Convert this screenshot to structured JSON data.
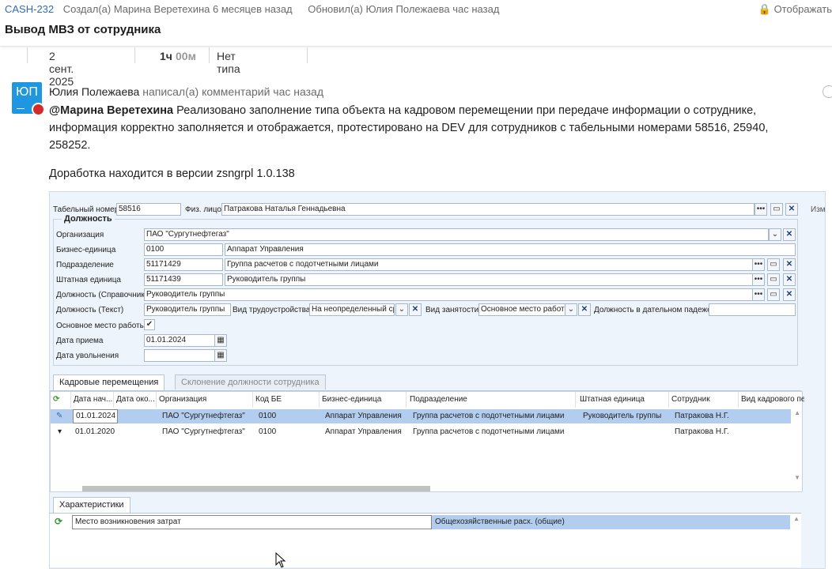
{
  "header": {
    "issue_key": "CASH-232",
    "created": "Создал(а) Марина Веретехина 6 месяцев назад",
    "updated": "Обновил(а) Юлия Полежаева час назад",
    "visibility": "Отображать",
    "title": "Вывод МВЗ от сотрудника"
  },
  "meta": {
    "date": "2 сент. 2025",
    "time_h": "1ч",
    "time_m": "00м",
    "type": "Нет типа"
  },
  "comment": {
    "avatar_initials": "ЮП",
    "author": "Юлия Полежаева",
    "action": "написал(а) комментарий час назад",
    "mention": "@Марина Веретехина",
    "text1": " Реализовано заполнение типа объекта на кадровом перемещении при передаче информации о сотруднике, информация корректно заполняется и отображается, протестировано на DEV для сотрудников с табельными номерами 58516, 25940, 258252.",
    "text2": "Доработка находится в версии zsngrpl 1.0.138"
  },
  "form": {
    "tab_num_label": "Табельный номер",
    "tab_num": "58516",
    "fiz_label": "Физ. лицо",
    "fiz_value": "Патракова Наталья Геннадьевна",
    "izm_label": "Изм",
    "group_title": "Должность",
    "org_label": "Организация",
    "org_value": "ПАО \"Сургутнефтегаз\"",
    "be_label": "Бизнес-единица",
    "be_code": "0100",
    "be_value": "Аппарат Управления",
    "podr_label": "Подразделение",
    "podr_code": "51171429",
    "podr_value": "Группа расчетов с подотчетными лицами",
    "sht_label": "Штатная единица",
    "sht_code": "51171439",
    "sht_value": "Руководитель группы",
    "dolzh_spr_label": "Должность (Справочник)",
    "dolzh_spr_value": "Руководитель группы",
    "dolzh_txt_label": "Должность (Текст)",
    "dolzh_txt_value": "Руководитель группы",
    "vid_tr_label": "Вид трудоустройства",
    "vid_tr_value": "На неопределенный срок",
    "vid_zan_label": "Вид занятости",
    "vid_zan_value": "Основное место работы",
    "dolzh_dat_label": "Должность в дательном падеже",
    "osn_label": "Основное место работы",
    "date_priem_label": "Дата приема",
    "date_priem": "01.01.2024",
    "date_uvol_label": "Дата увольнения",
    "ellipsis": "•••",
    "x": "✕",
    "check": "✔"
  },
  "tabs": [
    "Кадровые перемещения",
    "Склонение должности сотрудника"
  ],
  "grid": {
    "columns": [
      "Дата нач...",
      "Дата око...",
      "Организация",
      "Код БЕ",
      "Бизнес-единица",
      "Подразделение",
      "Штатная единица",
      "Сотрудник",
      "Вид кадрового пе"
    ],
    "rows": [
      [
        "01.01.2024",
        "",
        "ПАО \"Сургутнефтегаз\"",
        "0100",
        "Аппарат Управления",
        "Группа расчетов с подотчетными лицами",
        "Руководитель группы",
        "Патракова Н.Г.",
        ""
      ],
      [
        "01.01.2020",
        "",
        "ПАО \"Сургутнефтегаз\"",
        "0100",
        "Аппарат Управления",
        "Группа расчетов с подотчетными лицами",
        "",
        "Патракова Н.Г.",
        ""
      ]
    ]
  },
  "char_tab": "Характеристики",
  "char_row": {
    "name": "Место возникновения затрат",
    "value": "Общехозяйственные расх. (общие)"
  }
}
